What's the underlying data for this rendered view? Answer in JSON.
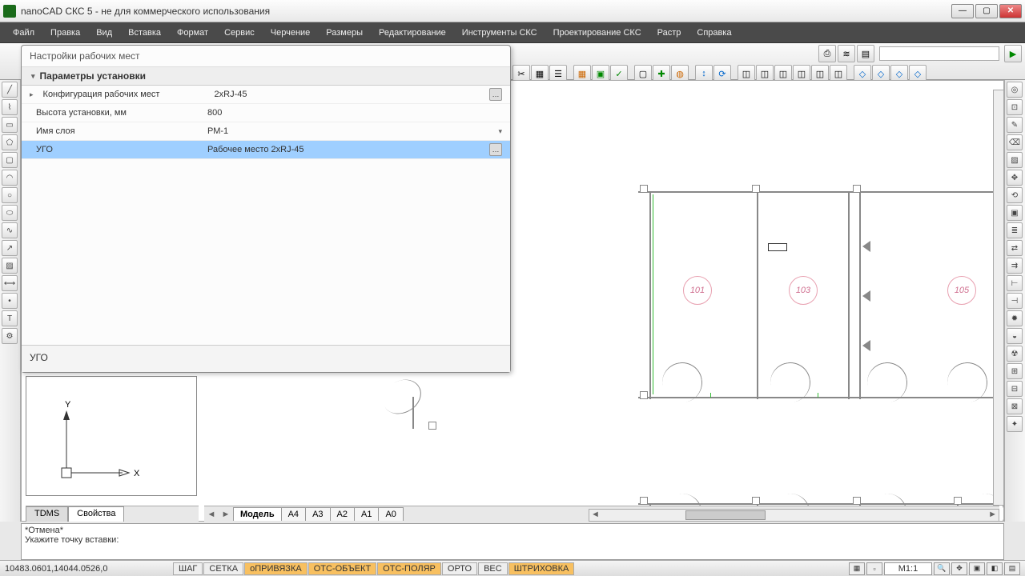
{
  "app": {
    "title": "nanoCAD СКС 5 - не для коммерческого использования"
  },
  "menu": [
    "Файл",
    "Правка",
    "Вид",
    "Вставка",
    "Формат",
    "Сервис",
    "Черчение",
    "Размеры",
    "Редактирование",
    "Инструменты СКС",
    "Проектирование СКС",
    "Растр",
    "Справка"
  ],
  "panel": {
    "title": "Настройки рабочих мест",
    "section": "Параметры установки",
    "rows": [
      {
        "label": "Конфигурация рабочих мест",
        "value": "2xRJ-45",
        "ctl": "ellipsis"
      },
      {
        "label": "Высота установки, мм",
        "value": "800",
        "ctl": "none"
      },
      {
        "label": "Имя слоя",
        "value": "РМ-1",
        "ctl": "dd"
      },
      {
        "label": "УГО",
        "value": "Рабочее место 2xRJ-45",
        "ctl": "ellipsis"
      }
    ],
    "footer": "УГО"
  },
  "rooms": [
    "101",
    "103",
    "105"
  ],
  "axis": {
    "x": "X",
    "y": "Y"
  },
  "sidetabs": [
    "TDMS",
    "Свойства"
  ],
  "modeltabs": [
    "Модель",
    "A4",
    "A3",
    "A2",
    "A1",
    "A0"
  ],
  "cmd": {
    "l1": "*Отмена*",
    "l2": "Укажите точку вставки:"
  },
  "status": {
    "coords": "10483.0601,14044.0526,0",
    "flags": [
      "ШАГ",
      "СЕТКА",
      "оПРИВЯЗКА",
      "ОТС-ОБЪЕКТ",
      "ОТС-ПОЛЯР",
      "ОРТО",
      "ВЕС",
      "ШТРИХОВКА"
    ],
    "flag_on": [
      false,
      false,
      true,
      true,
      true,
      false,
      false,
      true
    ],
    "scale": "М1:1"
  }
}
